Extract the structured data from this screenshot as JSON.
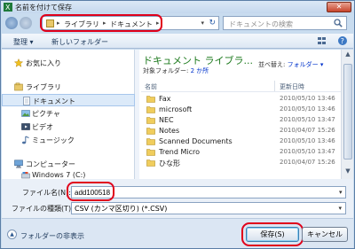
{
  "window": {
    "title": "名前を付けて保存",
    "close_label": "✕"
  },
  "address": {
    "crumbs": [
      "ライブラリ",
      "ドキュメント"
    ],
    "search_placeholder": "ドキュメントの検索"
  },
  "toolbar": {
    "organize": "整理 ▾",
    "new_folder": "新しいフォルダー"
  },
  "nav": {
    "items": [
      {
        "label": "お気に入り",
        "icon": "star-icon"
      },
      {
        "label": "ライブラリ",
        "icon": "library-icon"
      },
      {
        "label": "ドキュメント",
        "icon": "documents-icon"
      },
      {
        "label": "ピクチャ",
        "icon": "pictures-icon"
      },
      {
        "label": "ビデオ",
        "icon": "videos-icon"
      },
      {
        "label": "ミュージック",
        "icon": "music-icon"
      },
      {
        "label": "コンピューター",
        "icon": "computer-icon"
      },
      {
        "label": "Windows 7 (C:)",
        "icon": "drive-icon"
      }
    ]
  },
  "content": {
    "title": "ドキュメント ライブラ...",
    "subtitle_prefix": "対象フォルダー:",
    "subtitle_link": "2 か所",
    "arrange_label": "並べ替え:",
    "arrange_value": "フォルダー ▾",
    "columns": [
      "名前",
      "更新日時"
    ],
    "files": [
      {
        "name": "Fax",
        "date": "2010/05/10 13:46"
      },
      {
        "name": "microsoft",
        "date": "2010/05/10 13:46"
      },
      {
        "name": "NEC",
        "date": "2010/05/10 13:47"
      },
      {
        "name": "Notes",
        "date": "2010/04/07 15:26"
      },
      {
        "name": "Scanned Documents",
        "date": "2010/05/10 13:46"
      },
      {
        "name": "Trend Micro",
        "date": "2010/05/10 13:47"
      },
      {
        "name": "ひな形",
        "date": "2010/04/07 15:26"
      }
    ]
  },
  "form": {
    "filename_label": "ファイル名(N):",
    "filename_value": "add100518",
    "filetype_label": "ファイルの種類(T):",
    "filetype_value": "CSV (カンマ区切り) (*.CSV)"
  },
  "footer": {
    "hide_folders": "フォルダーの非表示",
    "save_label": "保存(S)",
    "cancel_label": "キャンセル"
  },
  "colors": {
    "highlight": "#e0001b",
    "library_title": "#1e7a1e",
    "link": "#0033cc"
  }
}
